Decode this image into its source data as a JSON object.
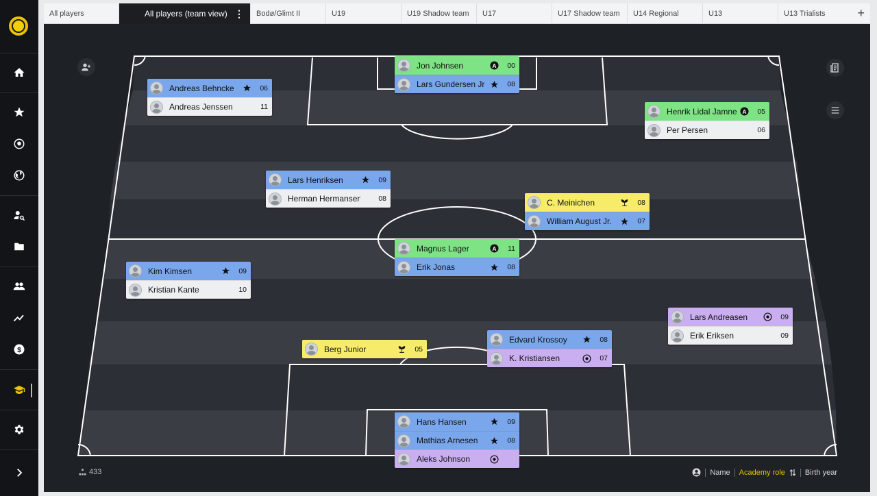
{
  "sidebar": {
    "items": [
      {
        "icon": "home-icon"
      },
      {
        "icon": "star-icon"
      },
      {
        "icon": "soccer-ball-icon"
      },
      {
        "icon": "globe-icon"
      },
      {
        "icon": "search-user-icon"
      },
      {
        "icon": "folder-icon"
      },
      {
        "icon": "people-icon"
      },
      {
        "icon": "trend-icon"
      },
      {
        "icon": "dollar-icon"
      },
      {
        "icon": "graduation-cap-icon",
        "active": true
      },
      {
        "icon": "gear-icon"
      },
      {
        "icon": "chevron-right-icon"
      }
    ],
    "accent": "#e9c200"
  },
  "tabs": [
    {
      "label": "All players"
    },
    {
      "label": "All players (team view)",
      "active": true
    },
    {
      "label": "Bodø/Glimt II"
    },
    {
      "label": "U19"
    },
    {
      "label": "U19 Shadow team"
    },
    {
      "label": "U17"
    },
    {
      "label": "U17 Shadow team"
    },
    {
      "label": "U14 Regional"
    },
    {
      "label": "U13"
    },
    {
      "label": "U13 Trialists"
    }
  ],
  "add_tab_label": "+",
  "positions": [
    {
      "players": [
        {
          "name": "Jon Johnsen",
          "role": "A",
          "year": "00",
          "color": "green"
        },
        {
          "name": "Lars Gundersen Jr",
          "role": "star",
          "year": "08",
          "color": "blue"
        }
      ]
    },
    {
      "players": [
        {
          "name": "Andreas Behncke",
          "role": "star",
          "year": "06",
          "color": "blue"
        },
        {
          "name": "Andreas Jenssen",
          "role": "",
          "year": "11",
          "color": "white"
        }
      ]
    },
    {
      "players": [
        {
          "name": "Henrik Lidal Jamne",
          "role": "A",
          "year": "05",
          "color": "green"
        },
        {
          "name": "Per Persen",
          "role": "",
          "year": "06",
          "color": "white"
        }
      ]
    },
    {
      "players": [
        {
          "name": "Lars Henriksen",
          "role": "star",
          "year": "09",
          "color": "blue"
        },
        {
          "name": "Herman Hermansen",
          "role": "",
          "year": "08",
          "color": "white"
        }
      ]
    },
    {
      "players": [
        {
          "name": "C. Meinichen",
          "role": "sprout",
          "year": "08",
          "color": "yellow"
        },
        {
          "name": "William August Jr.",
          "role": "star",
          "year": "07",
          "color": "blue"
        }
      ]
    },
    {
      "players": [
        {
          "name": "Magnus Lager",
          "role": "A",
          "year": "11",
          "color": "green"
        },
        {
          "name": "Erik Jonas",
          "role": "star",
          "year": "08",
          "color": "blue"
        }
      ]
    },
    {
      "players": [
        {
          "name": "Kim Kimsen",
          "role": "star",
          "year": "09",
          "color": "blue"
        },
        {
          "name": "Kristian Kante",
          "role": "",
          "year": "10",
          "color": "white"
        }
      ]
    },
    {
      "players": [
        {
          "name": "Lars Andreasen",
          "role": "target",
          "year": "09",
          "color": "purple"
        },
        {
          "name": "Erik Eriksen",
          "role": "",
          "year": "09",
          "color": "white"
        }
      ]
    },
    {
      "players": [
        {
          "name": "Berg Junior",
          "role": "sprout",
          "year": "05",
          "color": "yellow"
        }
      ]
    },
    {
      "players": [
        {
          "name": "Edvard Krossoy",
          "role": "star",
          "year": "08",
          "color": "blue"
        },
        {
          "name": "K. Kristiansen",
          "role": "target",
          "year": "07",
          "color": "purple"
        }
      ]
    },
    {
      "players": [
        {
          "name": "Hans Hansen",
          "role": "star",
          "year": "09",
          "color": "blue"
        },
        {
          "name": "Mathias Arnesen",
          "role": "star",
          "year": "08",
          "color": "blue"
        },
        {
          "name": "Aleks Johnson",
          "role": "target",
          "year": "",
          "color": "purple"
        }
      ]
    }
  ],
  "controls": {
    "add_player_icon": "add-user-icon",
    "report_icon": "report-icon",
    "menu_icon": "hamburger-icon"
  },
  "footer": {
    "formation": "433",
    "formation_icon": "formation-icon",
    "sort_icon": "person-circle-icon",
    "sort_options": [
      {
        "label": "Name"
      },
      {
        "label": "Academy role",
        "selected": true
      },
      {
        "label": "Birth year"
      }
    ],
    "sort_direction_icon": "sort-arrows-icon"
  },
  "colors": {
    "green": "#7ee384",
    "blue": "#7aa6ec",
    "white": "#eeeff1",
    "yellow": "#f7ec6a",
    "purple": "#c9aef0",
    "selected": "#e9c200"
  }
}
